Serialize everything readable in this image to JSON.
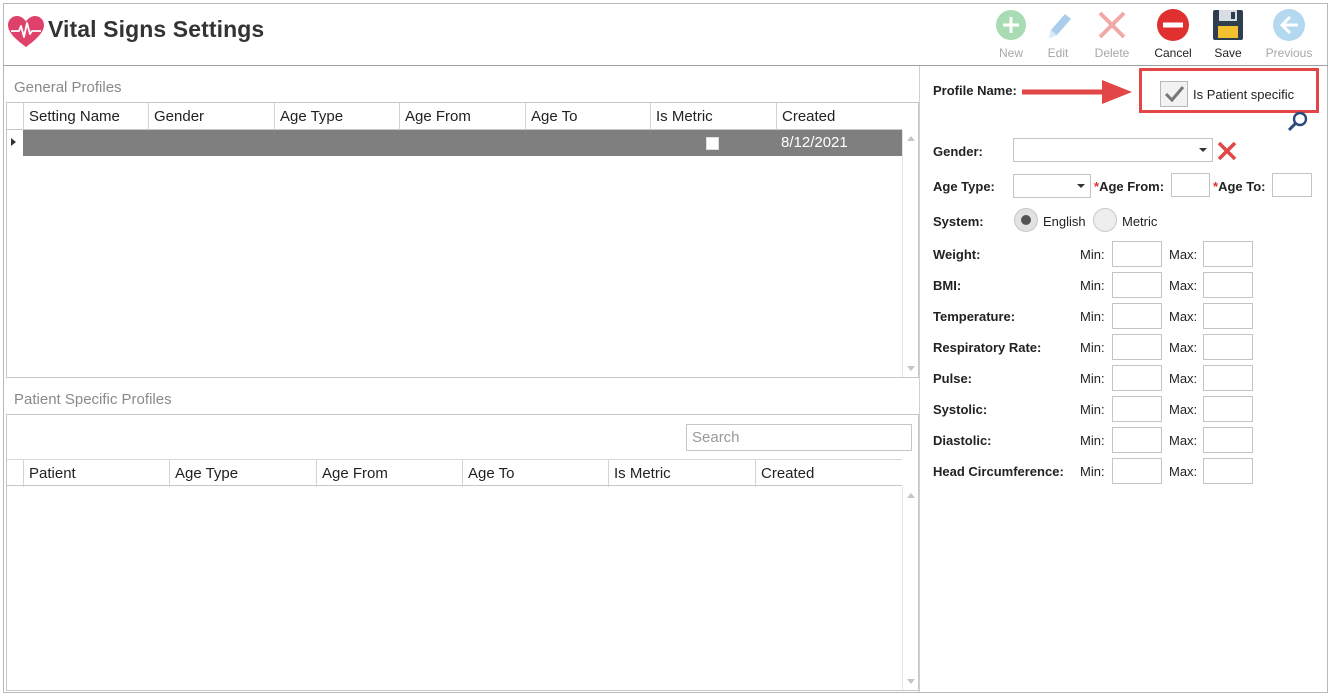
{
  "header": {
    "title": "Vital Signs Settings",
    "toolbar": [
      {
        "key": "new",
        "label": "New",
        "enabled": false,
        "icon": "plus-circle-icon"
      },
      {
        "key": "edit",
        "label": "Edit",
        "enabled": false,
        "icon": "pencil-icon"
      },
      {
        "key": "delete",
        "label": "Delete",
        "enabled": false,
        "icon": "x-icon"
      },
      {
        "key": "cancel",
        "label": "Cancel",
        "enabled": true,
        "icon": "no-entry-icon"
      },
      {
        "key": "save",
        "label": "Save",
        "enabled": true,
        "icon": "floppy-disk-icon"
      },
      {
        "key": "previous",
        "label": "Previous",
        "enabled": false,
        "icon": "back-arrow-icon"
      }
    ]
  },
  "general_profiles": {
    "title": "General Profiles",
    "columns": [
      "Setting Name",
      "Gender",
      "Age Type",
      "Age From",
      "Age To",
      "Is Metric",
      "Created"
    ],
    "rows": [
      {
        "setting_name": "",
        "gender": "",
        "age_type": "",
        "age_from": "",
        "age_to": "",
        "is_metric": false,
        "created": "8/12/2021"
      }
    ]
  },
  "patient_profiles": {
    "title": "Patient Specific Profiles",
    "search_placeholder": "Search",
    "columns": [
      "Patient",
      "Age Type",
      "Age From",
      "Age To",
      "Is Metric",
      "Created"
    ],
    "rows": []
  },
  "form": {
    "profile_name_label": "Profile Name:",
    "is_patient_specific_label": "Is Patient specific",
    "is_patient_specific_checked": true,
    "gender_label": "Gender:",
    "age_type_label": "Age Type:",
    "age_from_label": "Age From:",
    "age_to_label": "Age To:",
    "required_marker": "*",
    "system_label": "System:",
    "system_options": [
      "English",
      "Metric"
    ],
    "system_selected": "English",
    "min_label": "Min:",
    "max_label": "Max:",
    "vitals": [
      "Weight:",
      "BMI:",
      "Temperature:",
      "Respiratory Rate:",
      "Pulse:",
      "Systolic:",
      "Diastolic:",
      "Head Circumference:"
    ]
  },
  "colors": {
    "accent_red": "#e24646",
    "selected_row": "#7f7f7f",
    "logo_pink": "#e0416b"
  }
}
